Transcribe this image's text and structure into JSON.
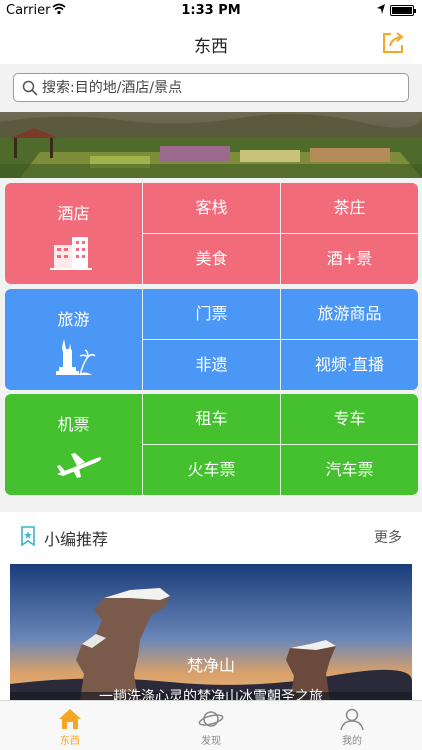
{
  "status_bar": {
    "carrier": "Carrier",
    "time": "1:33 PM"
  },
  "nav": {
    "title": "东西",
    "share_icon": "share-icon",
    "accent": "#f5a623"
  },
  "search": {
    "placeholder": "搜索:目的地/酒店/景点"
  },
  "categories": [
    {
      "main": "酒店",
      "icon": "hotel-building-icon",
      "color": "#f26b7a",
      "items": [
        "客栈",
        "茶庄",
        "美食",
        "酒+景"
      ]
    },
    {
      "main": "旅游",
      "icon": "statue-of-liberty-icon",
      "color": "#4b97f5",
      "items": [
        "门票",
        "旅游商品",
        "非遗",
        "视频·直播"
      ]
    },
    {
      "main": "机票",
      "icon": "airplane-icon",
      "color": "#45c130",
      "items": [
        "租车",
        "专车",
        "火车票",
        "汽车票"
      ]
    }
  ],
  "recommend": {
    "title": "小编推荐",
    "more": "更多",
    "card": {
      "name": "梵净山",
      "desc": "一趟洗涤心灵的梵净山冰雪朝圣之旅"
    }
  },
  "tabs": [
    {
      "label": "东西",
      "icon": "home-icon",
      "active": true
    },
    {
      "label": "发现",
      "icon": "planet-icon",
      "active": false
    },
    {
      "label": "我的",
      "icon": "person-icon",
      "active": false
    }
  ]
}
